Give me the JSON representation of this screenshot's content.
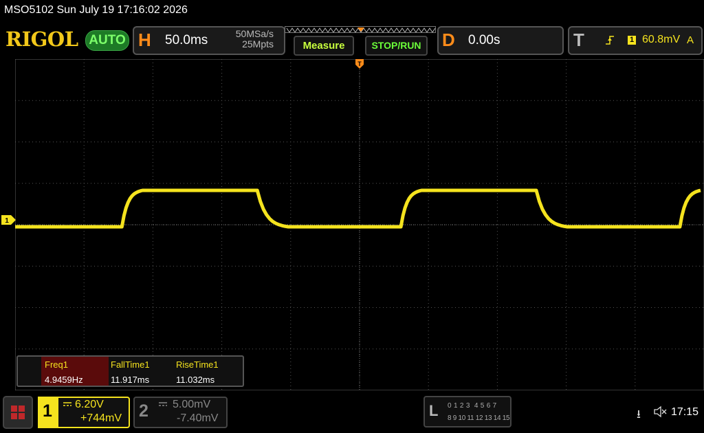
{
  "title": "MSO5102  Sun July 19 17:16:02 2026",
  "brand": {
    "logo": "RIGOL",
    "mode_badge": "AUTO"
  },
  "horizontal": {
    "letter": "H",
    "timebase": "50.0ms",
    "sample_rate": "50MSa/s",
    "memory_depth": "25Mpts"
  },
  "buttons": {
    "measure": "Measure",
    "stop_run": "STOP/RUN"
  },
  "delay": {
    "letter": "D",
    "value": "0.00s"
  },
  "trigger": {
    "letter": "T",
    "source": "1",
    "level": "60.8mV",
    "mode": "A"
  },
  "waveform": {
    "channel": "1",
    "color": "#f5e31e",
    "low_div": -0.05,
    "high_div": 0.83,
    "period_div": 4.05,
    "rise_start_div": 1.55
  },
  "measurements": [
    {
      "name": "Freq1",
      "value": "4.9459Hz"
    },
    {
      "name": "FallTime1",
      "value": "11.917ms"
    },
    {
      "name": "RiseTime1",
      "value": "11.032ms"
    }
  ],
  "channels": {
    "ch1": {
      "number": "1",
      "scale": "6.20V",
      "offset": "+744mV"
    },
    "ch2": {
      "number": "2",
      "scale": "5.00mV",
      "offset": "-7.40mV"
    }
  },
  "logic": {
    "letter": "L",
    "row1": "0 1 2 3  4 5 6 7",
    "row2": "8 9 10 11 12 13 14 15"
  },
  "status": {
    "usb_icon": "usb-icon",
    "sound_icon": "sound-muted-icon",
    "time": "17:15"
  },
  "colors": {
    "ch1": "#f5e31e",
    "accent_orange": "#ff8c1a",
    "auto_green": "#7cff6a"
  }
}
